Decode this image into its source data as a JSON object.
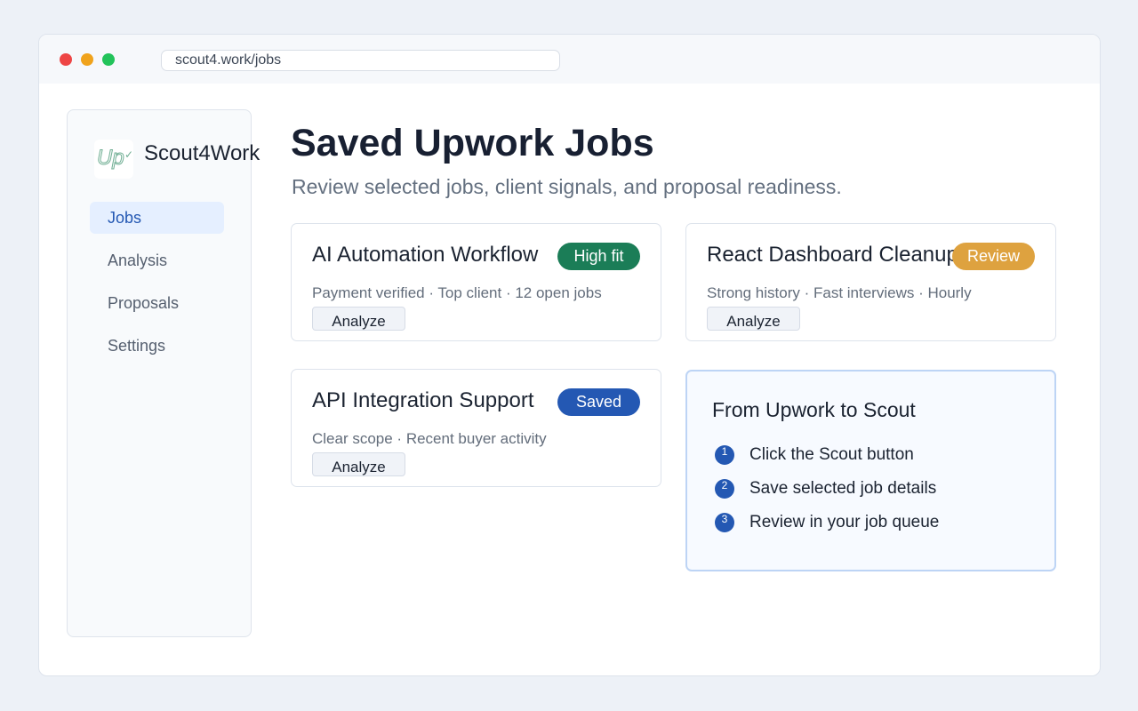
{
  "browser": {
    "url": "scout4.work/jobs"
  },
  "sidebar": {
    "logo_text": "Up",
    "brand": "Scout4Work",
    "items": [
      {
        "label": "Jobs",
        "active": true
      },
      {
        "label": "Analysis",
        "active": false
      },
      {
        "label": "Proposals",
        "active": false
      },
      {
        "label": "Settings",
        "active": false
      }
    ]
  },
  "main": {
    "title": "Saved Upwork Jobs",
    "subtitle": "Review selected jobs, client signals, and proposal readiness.",
    "jobs": [
      {
        "title": "AI Automation Workflow",
        "badge": "High fit",
        "badge_color": "#1b7d57",
        "meta": "Payment verified · Top client · 12 open jobs",
        "action": "Analyze"
      },
      {
        "title": "React Dashboard Cleanup",
        "badge": "Review",
        "badge_color": "#dea23f",
        "meta": "Strong history · Fast interviews · Hourly",
        "action": "Analyze"
      },
      {
        "title": "API Integration Support",
        "badge": "Saved",
        "badge_color": "#2458b3",
        "meta": "Clear scope · Recent buyer activity",
        "action": "Analyze"
      }
    ],
    "steps_panel": {
      "title": "From Upwork to Scout",
      "steps": [
        {
          "number": "1",
          "text": "Click the Scout button"
        },
        {
          "number": "2",
          "text": "Save selected job details"
        },
        {
          "number": "3",
          "text": "Review in your job queue"
        }
      ]
    }
  },
  "colors": {
    "accent": "#2458b3",
    "background": "#edf1f7",
    "panel_border": "#bdd4f5"
  }
}
